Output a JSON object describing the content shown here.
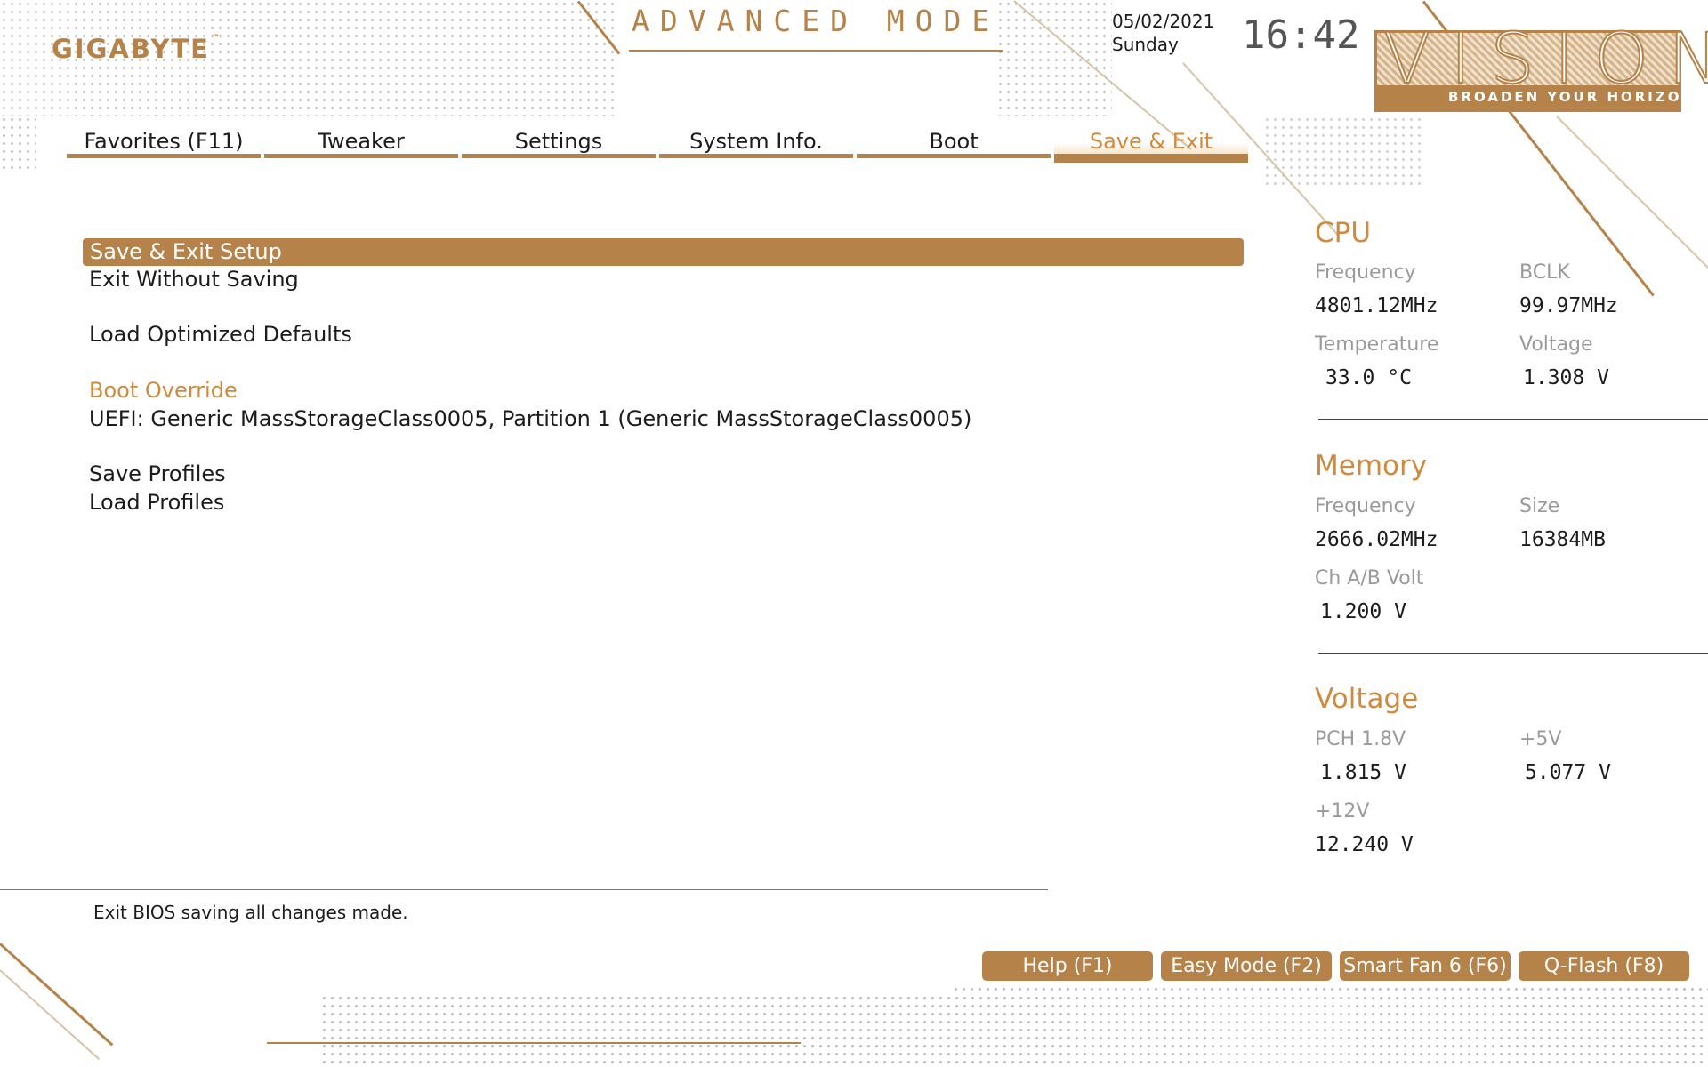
{
  "header": {
    "brand": "GIGABYTE",
    "trademark": "™",
    "mode_title": "ADVANCED MODE",
    "date": "05/02/2021",
    "day": "Sunday",
    "time": "16:42",
    "badge_title": "VISION",
    "badge_tagline": "BROADEN YOUR HORIZONS"
  },
  "tabs": [
    {
      "label": "Favorites (F11)"
    },
    {
      "label": "Tweaker"
    },
    {
      "label": "Settings"
    },
    {
      "label": "System Info."
    },
    {
      "label": "Boot"
    },
    {
      "label": "Save & Exit",
      "active": true
    }
  ],
  "menu": {
    "selected": "Save & Exit Setup",
    "exit_without_saving": "Exit Without Saving",
    "load_optimized_defaults": "Load Optimized Defaults",
    "boot_override_heading": "Boot Override",
    "boot_override_entry": "UEFI: Generic MassStorageClass0005, Partition 1 (Generic MassStorageClass0005)",
    "save_profiles": "Save Profiles",
    "load_profiles": "Load Profiles"
  },
  "help_text": "Exit BIOS saving all changes made.",
  "status": {
    "cpu": {
      "title": "CPU",
      "frequency_label": "Frequency",
      "frequency": "4801.12MHz",
      "bclk_label": "BCLK",
      "bclk": "99.97MHz",
      "temperature_label": "Temperature",
      "temperature": "33.0 °C",
      "voltage_label": "Voltage",
      "voltage": "1.308 V"
    },
    "memory": {
      "title": "Memory",
      "frequency_label": "Frequency",
      "frequency": "2666.02MHz",
      "size_label": "Size",
      "size": "16384MB",
      "chab_label": "Ch A/B Volt",
      "chab": "1.200 V"
    },
    "voltage": {
      "title": "Voltage",
      "pch_label": "PCH 1.8V",
      "pch": "1.815 V",
      "v5_label": "+5V",
      "v5": "5.077 V",
      "v12_label": "+12V",
      "v12": "12.240 V"
    }
  },
  "function_buttons": [
    {
      "label": "Help (F1)"
    },
    {
      "label": "Easy Mode (F2)"
    },
    {
      "label": "Smart Fan 6 (F6)"
    },
    {
      "label": "Q-Flash (F8)"
    }
  ],
  "colors": {
    "accent": "#b5834a",
    "accent_text": "#d08a3e",
    "text": "#1c1c1c",
    "muted_label": "#9a9a9a"
  }
}
